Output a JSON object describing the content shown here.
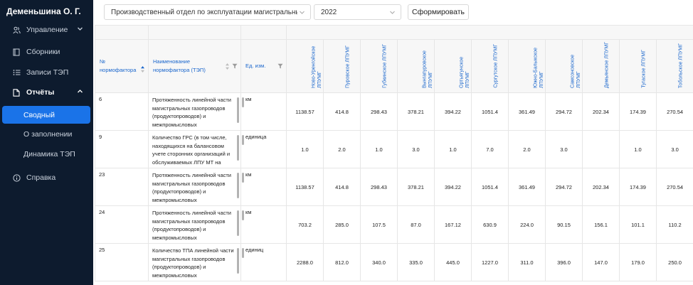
{
  "user": {
    "name": "Деменьшина О. Г."
  },
  "sidebar": {
    "items": [
      {
        "label": "Управление",
        "icon": "users-icon"
      },
      {
        "label": "Сборники",
        "icon": "book-icon"
      },
      {
        "label": "Записи ТЭП",
        "icon": "list-icon"
      },
      {
        "label": "Отчёты",
        "icon": "file-icon"
      },
      {
        "label": "Справка",
        "icon": "info-icon"
      }
    ],
    "reports_sub": [
      {
        "label": "Сводный"
      },
      {
        "label": "О заполнении"
      },
      {
        "label": "Динамика ТЭП"
      }
    ]
  },
  "toolbar": {
    "department_value": "Производственный отдел по эксплуатации магистральных газ...",
    "year_value": "2022",
    "generate_label": "Сформировать"
  },
  "table": {
    "headers": {
      "norm": "№ нормофактора",
      "name": "Наименование нормофактора (ТЭП)",
      "unit": "Ед. изм."
    },
    "lpu_columns": [
      "Ново-Уренгойское ЛПУМГ",
      "Пуровское ЛПУМГ",
      "Губкинское ЛПУМГ",
      "Вынгапуровское ЛПУМГ",
      "Ортьягунское ЛПУМГ",
      "Сургутское ЛПУМГ",
      "Южно-Балыкское ЛПУМГ",
      "Самсоновское ЛПУМГ",
      "Демьянское ЛПУМГ",
      "Тугаское ЛПУМГ",
      "Тобольское ЛПУМГ"
    ],
    "rows": [
      {
        "id": "6",
        "name": "Протяженность линейной части магистральных газопроводов (продуктопроводов) и межпромысловых",
        "unit": "км",
        "values": [
          "1138.57",
          "414.8",
          "298.43",
          "378.21",
          "394.22",
          "1051.4",
          "361.49",
          "294.72",
          "202.34",
          "174.39",
          "270.54"
        ]
      },
      {
        "id": "9",
        "name": "Количество ГРС (в том числе, находящихся на балансовом учете сторонних организаций и обслуживаемых ЛПУ МТ на",
        "unit": "единица",
        "values": [
          "1.0",
          "2.0",
          "1.0",
          "3.0",
          "1.0",
          "7.0",
          "2.0",
          "3.0",
          "",
          "1.0",
          "3.0"
        ]
      },
      {
        "id": "23",
        "name": "Протяженность линейной части магистральных газопроводов (продуктопроводов) и межпромысловых",
        "unit": "км",
        "values": [
          "1138.57",
          "414.8",
          "298.43",
          "378.21",
          "394.22",
          "1051.4",
          "361.49",
          "294.72",
          "202.34",
          "174.39",
          "270.54"
        ]
      },
      {
        "id": "24",
        "name": "Протяженность линейной части магистральных газопроводов (продуктопроводов) и межпромысловых",
        "unit": "км",
        "values": [
          "703.2",
          "285.0",
          "107.5",
          "87.0",
          "167.12",
          "630.9",
          "224.0",
          "90.15",
          "156.1",
          "101.1",
          "110.2"
        ]
      },
      {
        "id": "25",
        "name": "Количество ТПА линейной части магистральных газопроводов (продуктопроводов) и межпромысловых",
        "unit": "единиц",
        "values": [
          "2288.0",
          "812.0",
          "340.0",
          "335.0",
          "445.0",
          "1227.0",
          "311.0",
          "396.0",
          "147.0",
          "179.0",
          "250.0"
        ]
      }
    ]
  }
}
